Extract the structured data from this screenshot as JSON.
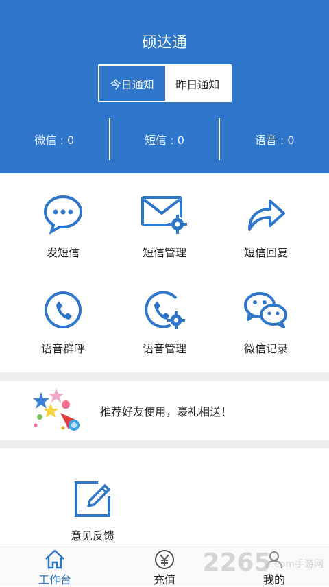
{
  "header": {
    "title": "硕达通",
    "tabs": [
      {
        "label": "今日通知",
        "active": true
      },
      {
        "label": "昨日通知",
        "active": false
      }
    ],
    "stats": [
      {
        "label": "微信 : 0"
      },
      {
        "label": "短信 : 0"
      },
      {
        "label": "语音 : 0"
      }
    ]
  },
  "grid": {
    "items": [
      {
        "label": "发短信",
        "icon": "chat-bubble-icon"
      },
      {
        "label": "短信管理",
        "icon": "envelope-gear-icon"
      },
      {
        "label": "短信回复",
        "icon": "reply-arrow-icon"
      },
      {
        "label": "语音群呼",
        "icon": "phone-circle-icon"
      },
      {
        "label": "语音管理",
        "icon": "phone-gear-icon"
      },
      {
        "label": "微信记录",
        "icon": "wechat-icon"
      }
    ]
  },
  "banner": {
    "text": "推荐好友使用，豪礼相送！",
    "icon": "party-stars-icon"
  },
  "feedback": {
    "label": "意见反馈",
    "icon": "edit-square-icon"
  },
  "tabbar": {
    "items": [
      {
        "label": "工作台",
        "icon": "home-icon",
        "active": true
      },
      {
        "label": "充值",
        "icon": "yen-circle-icon",
        "active": false
      },
      {
        "label": "我的",
        "icon": "user-icon",
        "active": false
      }
    ]
  },
  "watermark": {
    "text": "2265",
    "sub": ".com手游网"
  },
  "colors": {
    "primary": "#2e76c9",
    "divider": "#efefef"
  }
}
